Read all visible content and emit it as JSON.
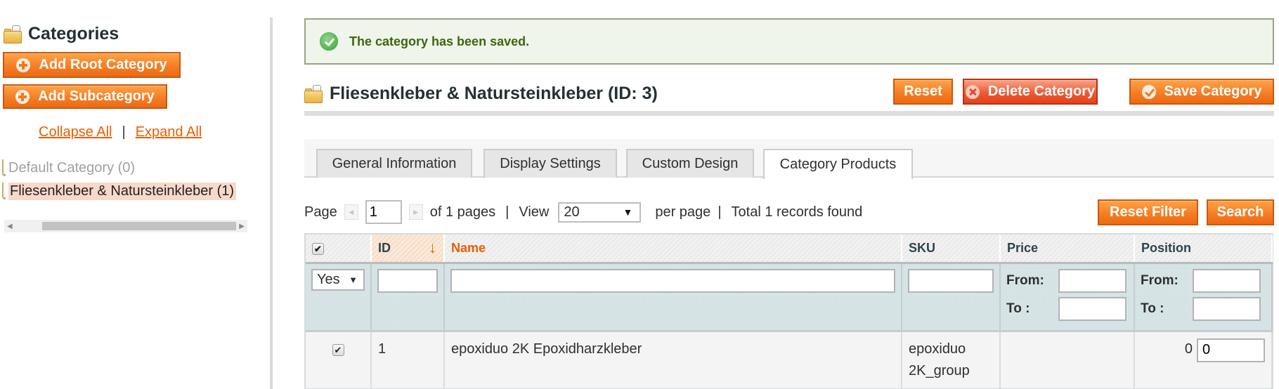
{
  "sidebar": {
    "title": "Categories",
    "add_root_label": "Add Root Category",
    "add_sub_label": "Add Subcategory",
    "collapse_all": "Collapse All",
    "separator": "|",
    "expand_all": "Expand All",
    "tree": [
      {
        "label": "Default Category (0)",
        "state": "disabled"
      },
      {
        "label": "Fliesenkleber & Natursteinkleber (1)",
        "state": "selected"
      }
    ]
  },
  "message": {
    "type": "success",
    "text": "The category has been saved."
  },
  "header": {
    "title": "Fliesenkleber & Natursteinkleber (ID: 3)",
    "reset_label": "Reset",
    "delete_label": "Delete Category",
    "save_label": "Save Category"
  },
  "tabs": [
    {
      "label": "General Information",
      "active": false
    },
    {
      "label": "Display Settings",
      "active": false
    },
    {
      "label": "Custom Design",
      "active": false
    },
    {
      "label": "Category Products",
      "active": true
    }
  ],
  "pager": {
    "page_label": "Page",
    "current_page": "1",
    "of_pages": "of 1 pages",
    "sep1": "|",
    "view_label": "View",
    "per_page_value": "20",
    "per_page_label": "per page",
    "sep2": "|",
    "total": "Total 1 records found",
    "reset_filter_label": "Reset Filter",
    "search_label": "Search"
  },
  "grid": {
    "columns": [
      {
        "key": "in_category",
        "label": ""
      },
      {
        "key": "id",
        "label": "ID",
        "sorted": "desc"
      },
      {
        "key": "name",
        "label": "Name"
      },
      {
        "key": "sku",
        "label": "SKU"
      },
      {
        "key": "price",
        "label": "Price"
      },
      {
        "key": "position",
        "label": "Position"
      }
    ],
    "filters": {
      "in_category_value": "Yes",
      "id_value": "",
      "name_value": "",
      "sku_value": "",
      "from_label": "From:",
      "to_label": "To :",
      "price_from": "",
      "price_to": "",
      "position_from": "",
      "position_to": ""
    },
    "rows": [
      {
        "checked": true,
        "id": "1",
        "name": "epoxiduo 2K Epoxidharzkleber",
        "sku_line1": "epoxiduo",
        "sku_line2": "2K_group",
        "price": "",
        "position_text": "0",
        "position_input": "0"
      }
    ]
  },
  "colors": {
    "accent_orange": "#eb5e00",
    "button_orange": "#f57e26",
    "delete_red": "#ef5a36",
    "success_text": "#3d6611",
    "success_bg": "#eff5ea"
  }
}
